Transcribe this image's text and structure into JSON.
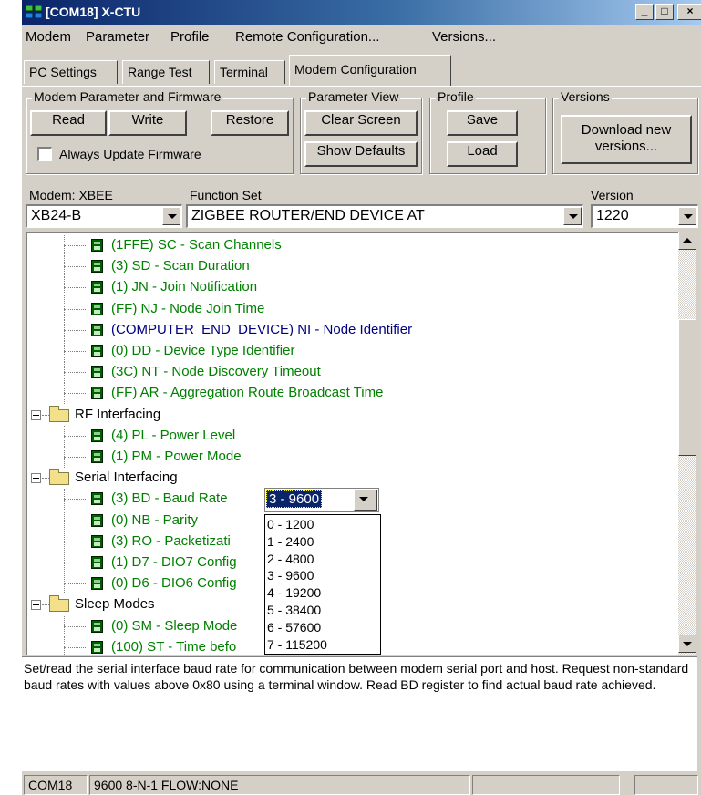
{
  "window": {
    "title": "[COM18] X-CTU",
    "controls": {
      "minimize": "_",
      "maximize": "□",
      "close": "×"
    }
  },
  "menu": [
    "Modem",
    "Parameter",
    "Profile",
    "Remote Configuration...",
    "Versions..."
  ],
  "tabs": [
    {
      "label": "PC Settings",
      "active": false
    },
    {
      "label": "Range Test",
      "active": false
    },
    {
      "label": "Terminal",
      "active": false
    },
    {
      "label": "Modem Configuration",
      "active": true
    }
  ],
  "groups": {
    "firmware": {
      "label": "Modem Parameter and Firmware",
      "read": "Read",
      "write": "Write",
      "restore": "Restore",
      "always_update": "Always Update Firmware",
      "always_update_checked": false
    },
    "parameter_view": {
      "label": "Parameter View",
      "clear_screen": "Clear Screen",
      "show_defaults": "Show Defaults"
    },
    "profile": {
      "label": "Profile",
      "save": "Save",
      "load": "Load"
    },
    "versions": {
      "label": "Versions",
      "download_line1": "Download new",
      "download_line2": "versions..."
    }
  },
  "selectors": {
    "modem_label": "Modem: XBEE",
    "modem_value": "XB24-B",
    "function_label": "Function Set",
    "function_value": "ZIGBEE ROUTER/END DEVICE AT",
    "version_label": "Version",
    "version_value": "1220"
  },
  "tree": {
    "items": [
      {
        "text": "(1FFE) SC - Scan Channels",
        "color": "#008000"
      },
      {
        "text": "(3) SD - Scan Duration",
        "color": "#008000"
      },
      {
        "text": "(1) JN - Join Notification",
        "color": "#008000"
      },
      {
        "text": "(FF) NJ - Node Join Time",
        "color": "#008000"
      },
      {
        "text": "(COMPUTER_END_DEVICE) NI - Node Identifier",
        "color": "#000080"
      },
      {
        "text": "(0) DD - Device Type Identifier",
        "color": "#008000"
      },
      {
        "text": "(3C) NT - Node Discovery Timeout",
        "color": "#008000"
      },
      {
        "text": "(FF) AR - Aggregation Route Broadcast Time",
        "color": "#008000"
      },
      {
        "text": "RF Interfacing",
        "color": "#000000"
      },
      {
        "text": "(4) PL - Power Level",
        "color": "#008000"
      },
      {
        "text": "(1) PM - Power Mode",
        "color": "#008000"
      },
      {
        "text": "Serial Interfacing",
        "color": "#000000"
      },
      {
        "text": "(3) BD - Baud Rate",
        "color": "#008000"
      },
      {
        "text": "(0) NB - Parity",
        "color": "#008000"
      },
      {
        "text": "(3) RO - Packetizati",
        "color": "#008000"
      },
      {
        "text": "(1) D7 - DIO7 Config",
        "color": "#008000"
      },
      {
        "text": "(0) D6 - DIO6 Config",
        "color": "#008000"
      },
      {
        "text": "Sleep Modes",
        "color": "#000000"
      },
      {
        "text": "(0) SM - Sleep Mode",
        "color": "#008000"
      },
      {
        "text": "(100) ST - Time befo",
        "color": "#008000"
      }
    ]
  },
  "editor": {
    "value": "3 - 9600",
    "options": [
      "0 - 1200",
      "1 - 2400",
      "2 - 4800",
      "3 - 9600",
      "4 - 19200",
      "5 - 38400",
      "6 - 57600",
      "7 - 115200"
    ]
  },
  "description": "Set/read the serial interface baud rate for communication between modem serial port and host. Request non-standard baud rates with values above 0x80 using a terminal window. Read BD register to find actual baud rate achieved.",
  "status": {
    "port": "COM18",
    "settings": "9600 8-N-1  FLOW:NONE",
    "cell3": "",
    "cell4": ""
  },
  "colors": {
    "title_active": "#0a246a",
    "window_face": "#d4d0c8",
    "param_default": "#008000",
    "param_changed": "#000080"
  }
}
